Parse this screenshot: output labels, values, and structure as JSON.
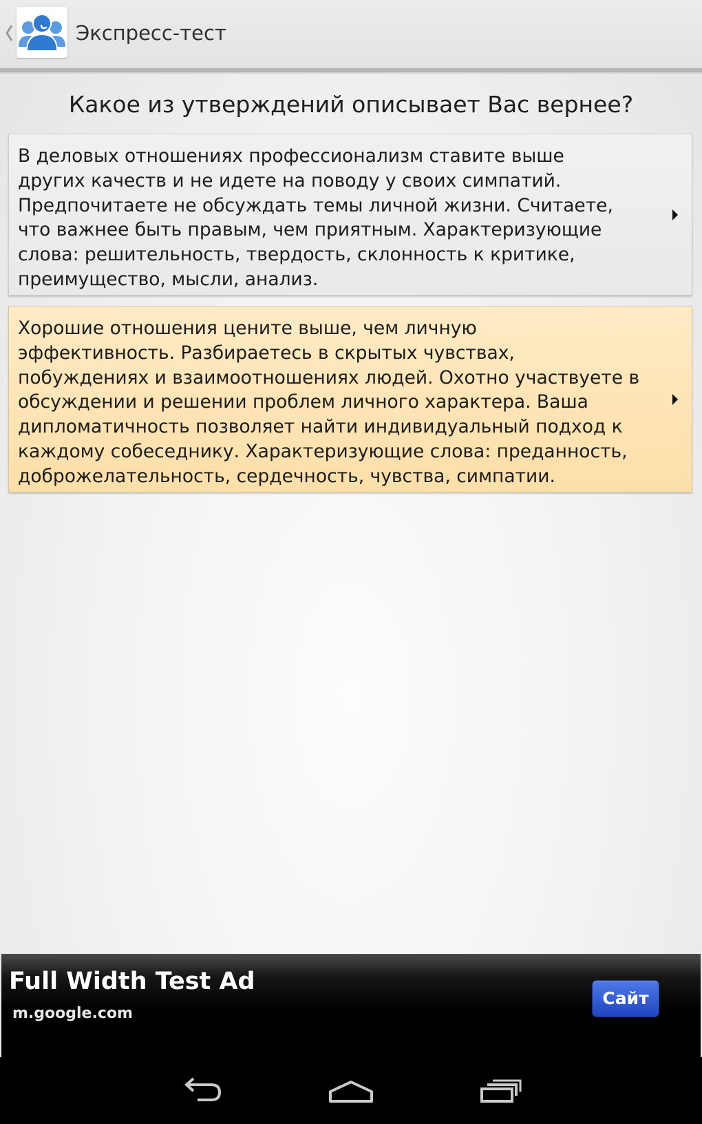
{
  "app": {
    "title": "Экспресс-тест",
    "icon": "people-group-icon"
  },
  "question": {
    "text": "Какое из утверждений описывает Вас вернее?"
  },
  "answers": [
    {
      "text": " В деловых отношениях профессионализм ставите выше\nдругих качеств и не идете на поводу у своих симпатий.\nПредпочитаете не обсуждать темы личной жизни. Считаете,\nчто важнее быть правым, чем приятным.  Характеризующие\nслова: решительность, твердость, склонность к критике,\nпреимущество, мысли, анализ.",
      "selected": false
    },
    {
      "text": " Хорошие отношения цените выше, чем личную\nэффективность. Разбираетесь в скрытых чувствах,\nпобуждениях и взаимоотношениях людей. Охотно участвуете в\nобсуждении и решении проблем личного характера. Ваша\nдипломатичность позволяет найти индивидуальный подход к\nкаждому собеседнику.  Характеризующие слова: преданность,\nдоброжелательность, сердечность, чувства, симпатии.",
      "selected": true
    }
  ],
  "ad": {
    "title": "Full Width Test Ad",
    "url": "m.google.com",
    "button_label": "Сайт"
  },
  "nav": {
    "back_icon": "back-arrow-icon",
    "home_icon": "home-icon",
    "recent_icon": "recent-apps-icon"
  },
  "colors": {
    "selected_card": "#fde3b0",
    "card": "#eeeeee",
    "icon_blue": "#3a86d6",
    "ad_button": "#2a55d0"
  }
}
